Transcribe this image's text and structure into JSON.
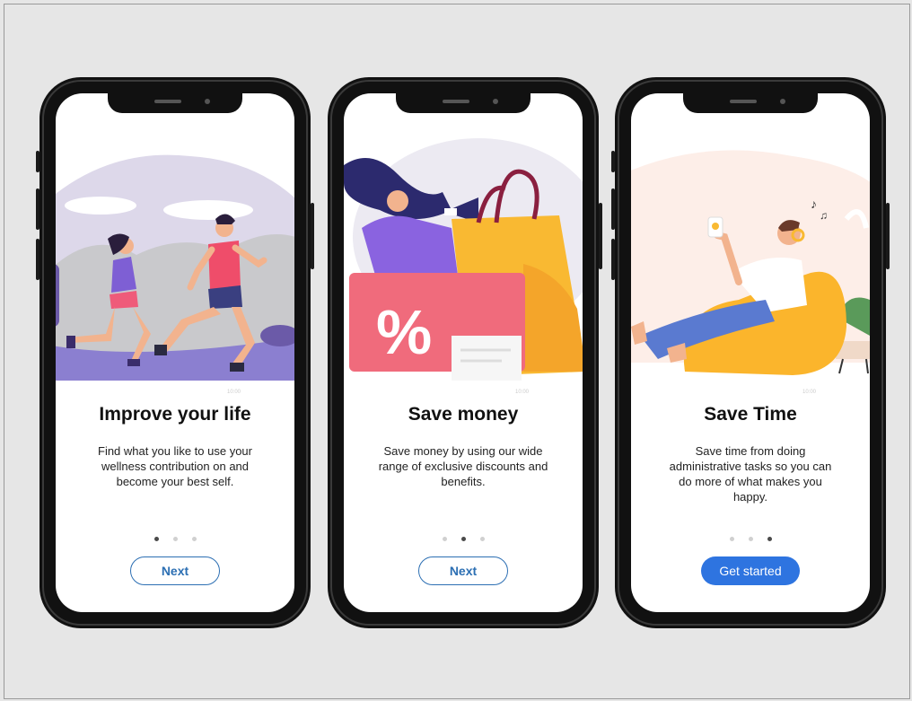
{
  "screens": [
    {
      "title": "Improve your life",
      "description": "Find what you like to use your wellness contribution on and become your best self.",
      "time_tag": "10:00",
      "button_label": "Next",
      "active_dot": 0
    },
    {
      "title": "Save money",
      "description": "Save money by using our wide range of exclusive discounts and benefits.",
      "time_tag": "10:00",
      "button_label": "Next",
      "active_dot": 1
    },
    {
      "title": "Save Time",
      "description": "Save time from doing administrative tasks so you can do more of what makes you happy.",
      "time_tag": "10:00",
      "button_label": "Get started",
      "active_dot": 2
    }
  ],
  "illustrations": [
    "runners-illustration",
    "shopping-illustration",
    "relaxing-illustration"
  ],
  "colors": {
    "accent": "#2e74e0",
    "outline_button": "#2c6fb3",
    "background": "#e6e6e6"
  }
}
